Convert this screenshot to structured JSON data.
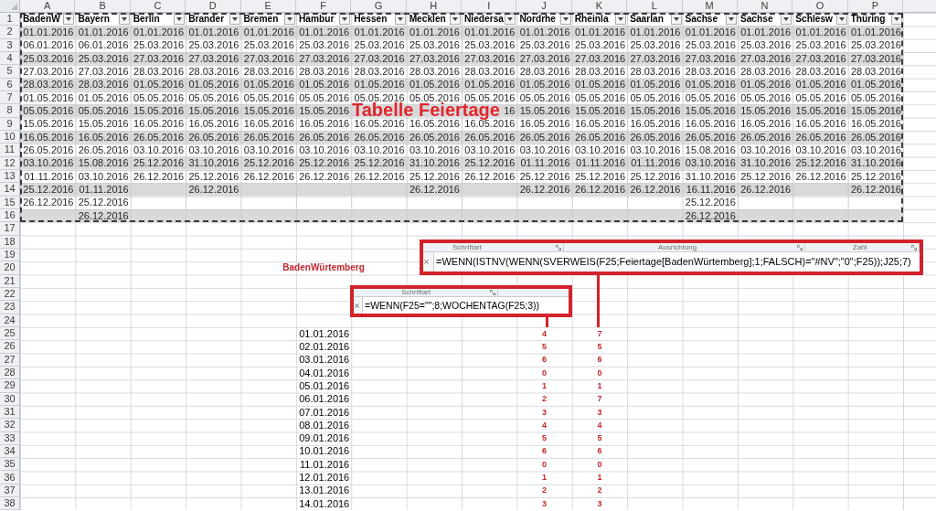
{
  "sheet": {
    "column_letters": [
      "A",
      "B",
      "C",
      "D",
      "E",
      "F",
      "G",
      "H",
      "I",
      "J",
      "K",
      "L",
      "M",
      "N",
      "O",
      "P"
    ],
    "row_numbers": [
      "1",
      "2",
      "3",
      "4",
      "5",
      "6",
      "7",
      "8",
      "9",
      "10",
      "11",
      "12",
      "13",
      "14",
      "15",
      "16",
      "17",
      "18",
      "19",
      "20",
      "21",
      "22",
      "23",
      "24",
      "25",
      "26",
      "27",
      "28",
      "29",
      "30",
      "31",
      "32",
      "33",
      "34",
      "35",
      "36",
      "37",
      "38"
    ]
  },
  "holiday_table": {
    "title": "Tabelle Feiertage",
    "columns": [
      {
        "header": "BadenW",
        "cells": [
          "01.01.2016",
          "06.01.2016",
          "25.03.2016",
          "27.03.2016",
          "28.03.2016",
          "01.05.2016",
          "05.05.2016",
          "15.05.2016",
          "16.05.2016",
          "26.05.2016",
          "03.10.2016",
          "01.11.2016",
          "25.12.2016",
          "26.12.2016"
        ]
      },
      {
        "header": "Bayern",
        "cells": [
          "01.01.2016",
          "06.01.2016",
          "25.03.2016",
          "27.03.2016",
          "28.03.2016",
          "01.05.2016",
          "05.05.2016",
          "15.05.2016",
          "16.05.2016",
          "26.05.2016",
          "15.08.2016",
          "03.10.2016",
          "01.11.2016",
          "25.12.2016",
          "26.12.2016"
        ]
      },
      {
        "header": "Berlin",
        "cells": [
          "01.01.2016",
          "25.03.2016",
          "27.03.2016",
          "28.03.2016",
          "01.05.2016",
          "05.05.2016",
          "15.05.2016",
          "16.05.2016",
          "26.05.2016",
          "03.10.2016",
          "25.12.2016",
          "26.12.2016"
        ]
      },
      {
        "header": "Brander",
        "cells": [
          "01.01.2016",
          "25.03.2016",
          "27.03.2016",
          "28.03.2016",
          "01.05.2016",
          "05.05.2016",
          "15.05.2016",
          "16.05.2016",
          "26.05.2016",
          "03.10.2016",
          "31.10.2016",
          "25.12.2016",
          "26.12.2016"
        ]
      },
      {
        "header": "Bremen",
        "cells": [
          "01.01.2016",
          "25.03.2016",
          "27.03.2016",
          "28.03.2016",
          "01.05.2016",
          "05.05.2016",
          "15.05.2016",
          "16.05.2016",
          "26.05.2016",
          "03.10.2016",
          "25.12.2016",
          "26.12.2016"
        ]
      },
      {
        "header": "Hambur",
        "cells": [
          "01.01.2016",
          "25.03.2016",
          "27.03.2016",
          "28.03.2016",
          "01.05.2016",
          "05.05.2016",
          "15.05.2016",
          "16.05.2016",
          "26.05.2016",
          "03.10.2016",
          "25.12.2016",
          "26.12.2016"
        ]
      },
      {
        "header": "Hessen",
        "cells": [
          "01.01.2016",
          "25.03.2016",
          "27.03.2016",
          "28.03.2016",
          "01.05.2016",
          "05.05.2016"
        ],
        "cells_below_title": [
          "16.05.2016",
          "26.05.2016",
          "03.10.2016",
          "25.12.2016",
          "26.12.2016"
        ]
      },
      {
        "header": "Mecklen",
        "cells": [
          "01.01.2016",
          "25.03.2016",
          "27.03.2016",
          "28.03.2016",
          "01.05.2016",
          "05.05.2016"
        ],
        "cells_below_title": [
          "16.05.2016",
          "26.05.2016",
          "03.10.2016",
          "31.10.2016",
          "25.12.2016",
          "26.12.2016"
        ]
      },
      {
        "header": "Niedersa",
        "cells": [
          "01.01.2016",
          "25.03.2016",
          "27.03.2016",
          "28.03.2016",
          "01.05.2016",
          "05.05.2016",
          "16",
          "16.05.2016",
          "26.05.2016",
          "03.10.2016",
          "25.12.2016",
          "26.12.2016"
        ]
      },
      {
        "header": "Nordrhe",
        "cells": [
          "01.01.2016",
          "25.03.2016",
          "27.03.2016",
          "28.03.2016",
          "01.05.2016",
          "05.05.2016",
          "15.05.2016",
          "16.05.2016",
          "26.05.2016",
          "03.10.2016",
          "01.11.2016",
          "25.12.2016",
          "26.12.2016"
        ]
      },
      {
        "header": "Rheinla",
        "cells": [
          "01.01.2016",
          "25.03.2016",
          "27.03.2016",
          "28.03.2016",
          "01.05.2016",
          "05.05.2016",
          "15.05.2016",
          "16.05.2016",
          "26.05.2016",
          "03.10.2016",
          "01.11.2016",
          "25.12.2016",
          "26.12.2016"
        ]
      },
      {
        "header": "Saarlan",
        "cells": [
          "01.01.2016",
          "25.03.2016",
          "27.03.2016",
          "28.03.2016",
          "01.05.2016",
          "05.05.2016",
          "15.05.2016",
          "16.05.2016",
          "26.05.2016",
          "03.10.2016",
          "01.11.2016",
          "25.12.2016",
          "26.12.2016"
        ]
      },
      {
        "header": "Sachse",
        "cells": [
          "01.01.2016",
          "25.03.2016",
          "27.03.2016",
          "28.03.2016",
          "01.05.2016",
          "05.05.2016",
          "15.05.2016",
          "16.05.2016",
          "26.05.2016",
          "15.08.2016",
          "03.10.2016",
          "31.10.2016",
          "16.11.2016",
          "25.12.2016",
          "26.12.2016"
        ]
      },
      {
        "header": "Sachse",
        "cells": [
          "01.01.2016",
          "25.03.2016",
          "27.03.2016",
          "28.03.2016",
          "01.05.2016",
          "05.05.2016",
          "15.05.2016",
          "16.05.2016",
          "26.05.2016",
          "03.10.2016",
          "31.10.2016",
          "25.12.2016",
          "26.12.2016"
        ]
      },
      {
        "header": "Schlesw",
        "cells": [
          "01.01.2016",
          "25.03.2016",
          "27.03.2016",
          "28.03.2016",
          "01.05.2016",
          "05.05.2016",
          "15.05.2016",
          "16.05.2016",
          "26.05.2016",
          "03.10.2016",
          "25.12.2016",
          "26.12.2016"
        ]
      },
      {
        "header": "Thüring",
        "cells": [
          "01.01.2016",
          "25.03.2016",
          "27.03.2016",
          "28.03.2016",
          "01.05.2016",
          "05.05.2016",
          "15.05.2016",
          "16.05.2016",
          "26.05.2016",
          "03.10.2016",
          "31.10.2016",
          "25.12.2016",
          "26.12.2016"
        ]
      }
    ]
  },
  "callouts": [
    {
      "ribbon_groups": [
        "Schriftart",
        "Ausrichtung",
        "Zahl"
      ],
      "formula": "=WENN(ISTNV(WENN(SVERWEIS(F25;Feiertage[BadenWürtemberg];1;FALSCH)=\"#NV\";\"0\";F25));J25;7)"
    },
    {
      "ribbon_groups": [
        "Schriftart"
      ],
      "formula": "=WENN(F25=\"\";8;WOCHENTAG(F25;3))"
    }
  ],
  "calculation": {
    "label": "BadenWürtemberg",
    "rows": [
      {
        "f": "01.01.2016",
        "j": "4",
        "k": "7"
      },
      {
        "f": "02.01.2016",
        "j": "5",
        "k": "5"
      },
      {
        "f": "03.01.2016",
        "j": "6",
        "k": "6"
      },
      {
        "f": "04.01.2016",
        "j": "0",
        "k": "0"
      },
      {
        "f": "05.01.2016",
        "j": "1",
        "k": "1"
      },
      {
        "f": "06.01.2016",
        "j": "2",
        "k": "7"
      },
      {
        "f": "07.01.2016",
        "j": "3",
        "k": "3"
      },
      {
        "f": "08.01.2016",
        "j": "4",
        "k": "4"
      },
      {
        "f": "09.01.2016",
        "j": "5",
        "k": "5"
      },
      {
        "f": "10.01.2016",
        "j": "6",
        "k": "6"
      },
      {
        "f": "11.01.2016",
        "j": "0",
        "k": "0"
      },
      {
        "f": "12.01.2016",
        "j": "1",
        "k": "1"
      },
      {
        "f": "13.01.2016",
        "j": "2",
        "k": "2"
      },
      {
        "f": "14.01.2016",
        "j": "3",
        "k": "3"
      }
    ]
  }
}
